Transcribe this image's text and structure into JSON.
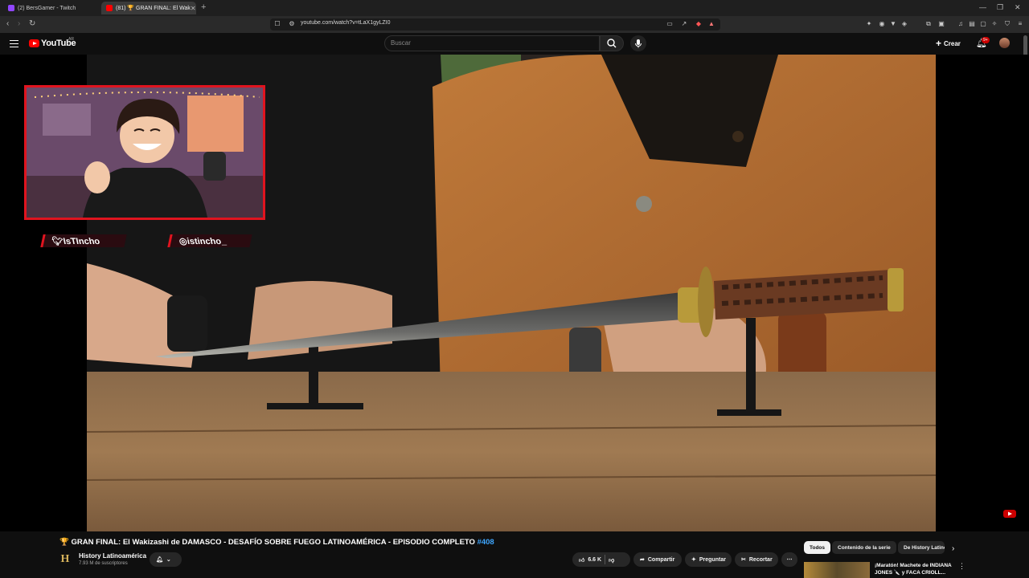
{
  "browser": {
    "tabs": [
      {
        "label": "(2) BersGamer - Twitch",
        "active": false
      },
      {
        "label": "(81) 🏆 GRAN FINAL: El Wak",
        "active": true
      }
    ],
    "new_tab": "+",
    "url": "youtube.com/watch?v=tLaX1gyLZI0"
  },
  "youtube": {
    "logo_text": "YouTube",
    "region": "AR",
    "search_placeholder": "Buscar",
    "create_label": "Crear",
    "notif_badge": "9+"
  },
  "overlay": {
    "twitter_handle": "IsTIncho",
    "instagram_handle": "istincho_"
  },
  "video": {
    "title_prefix": "🏆 GRAN FINAL: El Wakizashi de DAMASCO - DESAFÍO SOBRE FUEGO LATINOAMÉRICA - EPISODIO COMPLETO ",
    "title_hashtag": "#408",
    "channel_name": "History Latinoamérica",
    "channel_subs": "7.93 M de suscriptores",
    "channel_logo": "H",
    "likes": "6.6 K",
    "share_label": "Compartir",
    "ask_label": "Preguntar",
    "clip_label": "Recortar"
  },
  "chips": [
    "Todos",
    "Contenido de la serie",
    "De History Latinoamérica"
  ],
  "recommendation": {
    "title": "¡Maratón! Machete de INDIANA JONES 🔪 y FACA CRIOLL..."
  },
  "colors": {
    "accent": "#ff0000",
    "overlay_red": "#e0141f",
    "link": "#3ea6ff"
  }
}
